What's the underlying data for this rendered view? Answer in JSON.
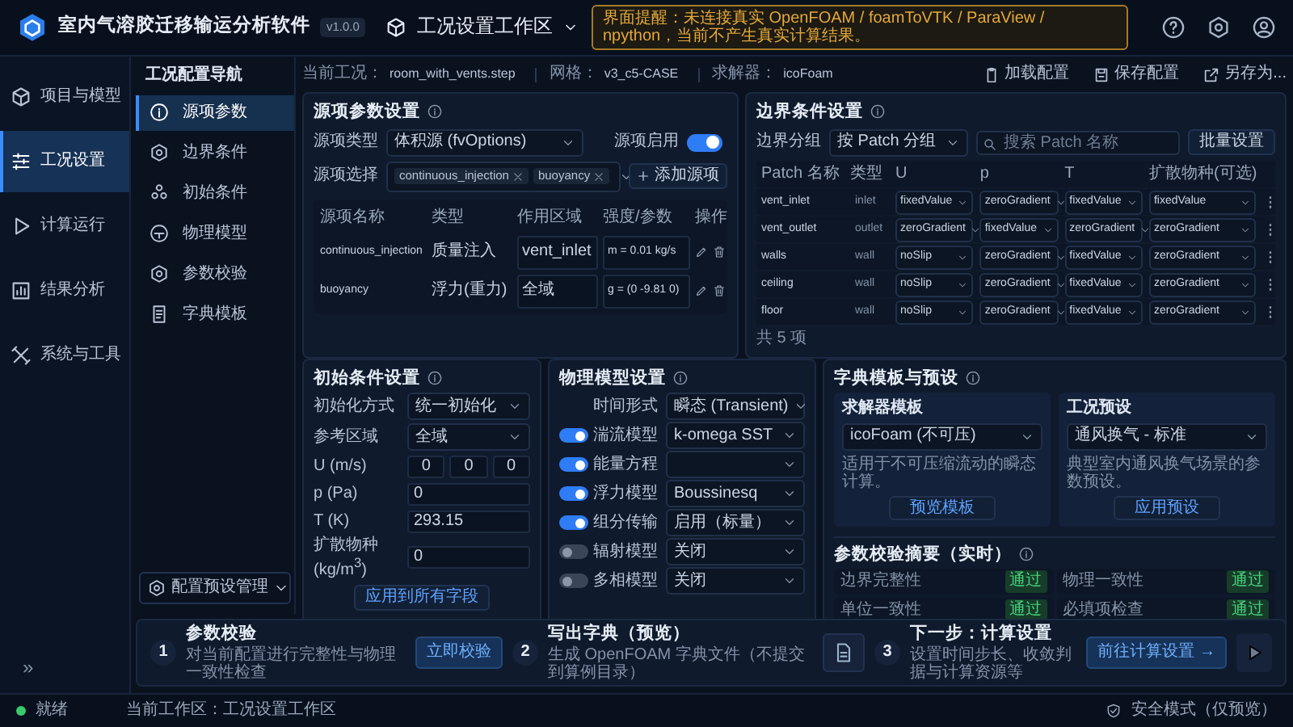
{
  "app": {
    "title": "室内气溶胶迁移输运分析软件",
    "version": "v1.0.0"
  },
  "workspace": {
    "title": "工况设置工作区"
  },
  "notice": "界面提醒：未连接真实 OpenFOAM / foamToVTK / ParaView / npython，当前不产生真实计算结果。",
  "rail": [
    {
      "label": "项目与模型",
      "selected": false
    },
    {
      "label": "工况设置",
      "selected": true
    },
    {
      "label": "计算运行",
      "selected": false
    },
    {
      "label": "结果分析",
      "selected": false
    },
    {
      "label": "系统与工具",
      "selected": false
    }
  ],
  "rail_expand": "»",
  "nav": {
    "title": "工况配置导航",
    "items": [
      {
        "label": "源项参数",
        "selected": true
      },
      {
        "label": "边界条件",
        "selected": false
      },
      {
        "label": "初始条件",
        "selected": false
      },
      {
        "label": "物理模型",
        "selected": false
      },
      {
        "label": "参数校验",
        "selected": false
      },
      {
        "label": "字典模板",
        "selected": false
      }
    ],
    "footer": "配置预设管理"
  },
  "info": [
    {
      "label": "当前工况：",
      "value": "room_with_vents.step"
    },
    {
      "label": "网格：",
      "value": "v3_c5-CASE"
    },
    {
      "label": "求解器：",
      "value": "icoFoam"
    }
  ],
  "actions": [
    "加载配置",
    "保存配置",
    "另存为..."
  ],
  "source": {
    "title": "源项参数设置",
    "type_label": "源项类型",
    "type_value": "体积源 (fvOptions)",
    "enable_label": "源项启用",
    "enabled": true,
    "select_label": "源项选择",
    "tags": [
      "continuous_injection",
      "buoyancy"
    ],
    "add": "添加源项",
    "columns": [
      "源项名称",
      "类型",
      "作用区域",
      "强度/参数",
      "操作"
    ],
    "rows": [
      {
        "name": "continuous_injection",
        "type": "质量注入",
        "region": "vent_inlet",
        "param": "m = 0.01 kg/s"
      },
      {
        "name": "buoyancy",
        "type": "浮力(重力)",
        "region": "全域",
        "param": "g = (0 -9.81 0)"
      }
    ]
  },
  "boundary": {
    "title": "边界条件设置",
    "group_label": "边界分组",
    "group_value": "按 Patch 分组",
    "search_placeholder": "搜索 Patch 名称",
    "batch": "批量设置",
    "columns": [
      "Patch 名称",
      "类型",
      "U",
      "p",
      "T",
      "扩散物种(可选)"
    ],
    "rows": [
      {
        "patch": "vent_inlet",
        "type": "inlet",
        "u": "fixedValue",
        "p": "zeroGradient",
        "t": "fixedValue",
        "species": "fixedValue"
      },
      {
        "patch": "vent_outlet",
        "type": "outlet",
        "u": "zeroGradient",
        "p": "fixedValue",
        "t": "zeroGradient",
        "species": "zeroGradient"
      },
      {
        "patch": "walls",
        "type": "wall",
        "u": "noSlip",
        "p": "zeroGradient",
        "t": "fixedValue",
        "species": "zeroGradient"
      },
      {
        "patch": "ceiling",
        "type": "wall",
        "u": "noSlip",
        "p": "zeroGradient",
        "t": "fixedValue",
        "species": "zeroGradient"
      },
      {
        "patch": "floor",
        "type": "wall",
        "u": "noSlip",
        "p": "zeroGradient",
        "t": "fixedValue",
        "species": "zeroGradient"
      }
    ],
    "count": "共 5 项"
  },
  "initial": {
    "title": "初始条件设置",
    "fields": [
      {
        "kind": "select",
        "label": "初始化方式",
        "value": "统一初始化"
      },
      {
        "kind": "select",
        "label": "参考区域",
        "value": "全域"
      },
      {
        "kind": "vector",
        "label": "U (m/s)",
        "values": [
          "0",
          "0",
          "0"
        ]
      },
      {
        "kind": "input",
        "label": "p (Pa)",
        "value": "0"
      },
      {
        "kind": "input",
        "label": "T (K)",
        "value": "293.15"
      },
      {
        "kind": "input",
        "label": "扩散物种 (kg/m$^{3}$)",
        "value": "0"
      }
    ],
    "apply": "应用到所有字段"
  },
  "physics": {
    "title": "物理模型设置",
    "rows": [
      {
        "kind": "plain",
        "label": "时间形式",
        "value": "瞬态 (Transient)"
      },
      {
        "kind": "toggle",
        "on": true,
        "label": "湍流模型",
        "value": "k-omega SST"
      },
      {
        "kind": "toggle",
        "on": true,
        "label": "能量方程"
      },
      {
        "kind": "toggle",
        "on": true,
        "label": "浮力模型",
        "value": "Boussinesq"
      },
      {
        "kind": "toggle",
        "on": true,
        "label": "组分传输",
        "value": "启用（标量）"
      },
      {
        "kind": "toggle",
        "on": false,
        "label": "辐射模型",
        "value": "关闭"
      },
      {
        "kind": "toggle",
        "on": false,
        "label": "多相模型",
        "value": "关闭"
      }
    ]
  },
  "dict": {
    "title": "字典模板与预设",
    "cards": [
      {
        "title": "求解器模板",
        "value": "icoFoam (不可压)",
        "desc": "适用于不可压缩流动的瞬态计算。",
        "button": "预览模板"
      },
      {
        "title": "工况预设",
        "value": "通风换气 - 标准",
        "desc": "典型室内通风换气场景的参数预设。",
        "button": "应用预设"
      }
    ]
  },
  "validation": {
    "title": "参数校验摘要（实时）",
    "items": [
      {
        "label": "边界完整性",
        "status": "通过"
      },
      {
        "label": "物理一致性",
        "status": "通过"
      },
      {
        "label": "单位一致性",
        "status": "通过"
      },
      {
        "label": "必填项检查",
        "status": "通过"
      }
    ]
  },
  "steps": [
    {
      "num": "1",
      "title": "参数校验",
      "desc": "对当前配置进行完整性与物理一致性检查",
      "kind": "button",
      "action": "立即校验"
    },
    {
      "num": "2",
      "title": "写出字典（预览）",
      "desc": "生成 OpenFOAM 字典文件（不提交到算例目录）",
      "kind": "icon"
    },
    {
      "num": "3",
      "title": "下一步：计算设置",
      "desc": "设置时间步长、收敛判据与计算资源等",
      "kind": "button",
      "action": "前往计算设置 →"
    }
  ],
  "status": {
    "state": "就绪",
    "workspace": "当前工作区：工况设置工作区",
    "mode": "安全模式（仅预览）"
  }
}
